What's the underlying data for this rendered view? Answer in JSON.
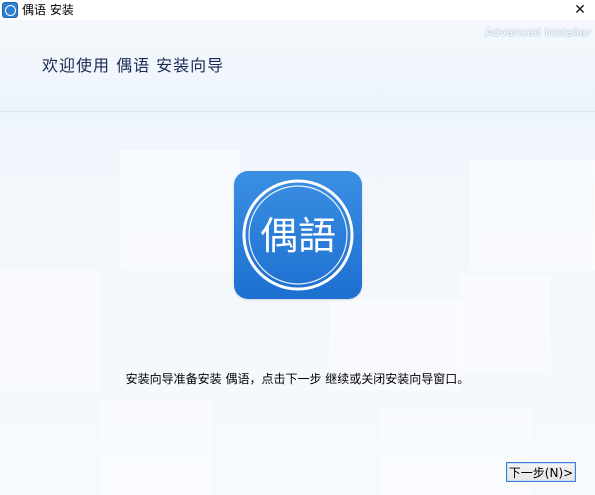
{
  "window": {
    "title": "偶语 安装",
    "close_glyph": "✕",
    "title_icon": "app-icon"
  },
  "header": {
    "watermark": "Advanced Installer",
    "title": "欢迎使用 偶语 安装向导"
  },
  "logo": {
    "text": "偶語",
    "icon": "app-logo",
    "colors": {
      "top": "#3b8fe2",
      "bottom": "#1d6fd0",
      "ring": "#ffffff"
    }
  },
  "body": {
    "description": "安装向导准备安装 偶语，点击下一步 继续或关闭安装向导窗口。"
  },
  "footer": {
    "next_label": "下一步(N)>"
  },
  "colors": {
    "background": "#eef4fb",
    "accent": "#3c7fd6",
    "title_text": "#1a2a52"
  }
}
